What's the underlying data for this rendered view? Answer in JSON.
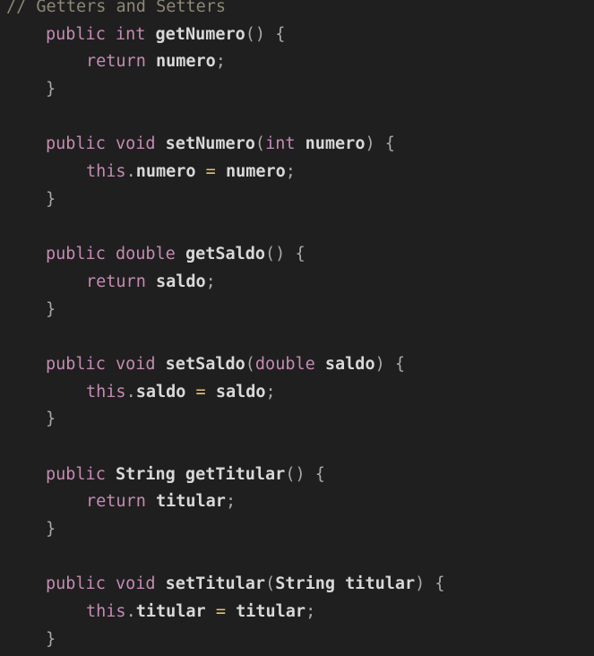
{
  "editor": {
    "theme": {
      "background": "#1f1f1f",
      "comment": "#8d8776",
      "keyword": "#c58bb3",
      "identifier": "#d8d8d8",
      "punctuation": "#a9a9a9",
      "operator": "#e7c274"
    },
    "lines": [
      {
        "indent": 0,
        "tokens": [
          {
            "t": "comment",
            "v": "// Getters and Setters"
          }
        ]
      },
      {
        "indent": 1,
        "tokens": [
          {
            "t": "kw",
            "v": "public int"
          },
          {
            "t": "text",
            "v": " "
          },
          {
            "t": "ident",
            "v": "getNumero"
          },
          {
            "t": "punc",
            "v": "() {"
          }
        ]
      },
      {
        "indent": 2,
        "tokens": [
          {
            "t": "kw",
            "v": "return"
          },
          {
            "t": "text",
            "v": " "
          },
          {
            "t": "ident",
            "v": "numero"
          },
          {
            "t": "punc",
            "v": ";"
          }
        ]
      },
      {
        "indent": 1,
        "tokens": [
          {
            "t": "punc",
            "v": "}"
          }
        ]
      },
      {
        "indent": 0,
        "tokens": []
      },
      {
        "indent": 1,
        "tokens": [
          {
            "t": "kw",
            "v": "public void"
          },
          {
            "t": "text",
            "v": " "
          },
          {
            "t": "ident",
            "v": "setNumero"
          },
          {
            "t": "punc",
            "v": "("
          },
          {
            "t": "kw",
            "v": "int"
          },
          {
            "t": "text",
            "v": " "
          },
          {
            "t": "ident",
            "v": "numero"
          },
          {
            "t": "punc",
            "v": ") {"
          }
        ]
      },
      {
        "indent": 2,
        "tokens": [
          {
            "t": "kw",
            "v": "this"
          },
          {
            "t": "punc",
            "v": "."
          },
          {
            "t": "ident",
            "v": "numero"
          },
          {
            "t": "text",
            "v": " "
          },
          {
            "t": "op",
            "v": "="
          },
          {
            "t": "text",
            "v": " "
          },
          {
            "t": "ident",
            "v": "numero"
          },
          {
            "t": "punc",
            "v": ";"
          }
        ]
      },
      {
        "indent": 1,
        "tokens": [
          {
            "t": "punc",
            "v": "}"
          }
        ]
      },
      {
        "indent": 0,
        "tokens": []
      },
      {
        "indent": 1,
        "tokens": [
          {
            "t": "kw",
            "v": "public double"
          },
          {
            "t": "text",
            "v": " "
          },
          {
            "t": "ident",
            "v": "getSaldo"
          },
          {
            "t": "punc",
            "v": "() {"
          }
        ]
      },
      {
        "indent": 2,
        "tokens": [
          {
            "t": "kw",
            "v": "return"
          },
          {
            "t": "text",
            "v": " "
          },
          {
            "t": "ident",
            "v": "saldo"
          },
          {
            "t": "punc",
            "v": ";"
          }
        ]
      },
      {
        "indent": 1,
        "tokens": [
          {
            "t": "punc",
            "v": "}"
          }
        ]
      },
      {
        "indent": 0,
        "tokens": []
      },
      {
        "indent": 1,
        "tokens": [
          {
            "t": "kw",
            "v": "public void"
          },
          {
            "t": "text",
            "v": " "
          },
          {
            "t": "ident",
            "v": "setSaldo"
          },
          {
            "t": "punc",
            "v": "("
          },
          {
            "t": "kw",
            "v": "double"
          },
          {
            "t": "text",
            "v": " "
          },
          {
            "t": "ident",
            "v": "saldo"
          },
          {
            "t": "punc",
            "v": ") {"
          }
        ]
      },
      {
        "indent": 2,
        "tokens": [
          {
            "t": "kw",
            "v": "this"
          },
          {
            "t": "punc",
            "v": "."
          },
          {
            "t": "ident",
            "v": "saldo"
          },
          {
            "t": "text",
            "v": " "
          },
          {
            "t": "op",
            "v": "="
          },
          {
            "t": "text",
            "v": " "
          },
          {
            "t": "ident",
            "v": "saldo"
          },
          {
            "t": "punc",
            "v": ";"
          }
        ]
      },
      {
        "indent": 1,
        "tokens": [
          {
            "t": "punc",
            "v": "}"
          }
        ]
      },
      {
        "indent": 0,
        "tokens": []
      },
      {
        "indent": 1,
        "tokens": [
          {
            "t": "kw",
            "v": "public"
          },
          {
            "t": "text",
            "v": " "
          },
          {
            "t": "ident",
            "v": "String getTitular"
          },
          {
            "t": "punc",
            "v": "() {"
          }
        ]
      },
      {
        "indent": 2,
        "tokens": [
          {
            "t": "kw",
            "v": "return"
          },
          {
            "t": "text",
            "v": " "
          },
          {
            "t": "ident",
            "v": "titular"
          },
          {
            "t": "punc",
            "v": ";"
          }
        ]
      },
      {
        "indent": 1,
        "tokens": [
          {
            "t": "punc",
            "v": "}"
          }
        ]
      },
      {
        "indent": 0,
        "tokens": []
      },
      {
        "indent": 1,
        "tokens": [
          {
            "t": "kw",
            "v": "public void"
          },
          {
            "t": "text",
            "v": " "
          },
          {
            "t": "ident",
            "v": "setTitular"
          },
          {
            "t": "punc",
            "v": "("
          },
          {
            "t": "ident",
            "v": "String titular"
          },
          {
            "t": "punc",
            "v": ") {"
          }
        ]
      },
      {
        "indent": 2,
        "tokens": [
          {
            "t": "kw",
            "v": "this"
          },
          {
            "t": "punc",
            "v": "."
          },
          {
            "t": "ident",
            "v": "titular"
          },
          {
            "t": "text",
            "v": " "
          },
          {
            "t": "op",
            "v": "="
          },
          {
            "t": "text",
            "v": " "
          },
          {
            "t": "ident",
            "v": "titular"
          },
          {
            "t": "punc",
            "v": ";"
          }
        ]
      },
      {
        "indent": 1,
        "tokens": [
          {
            "t": "punc",
            "v": "}"
          }
        ]
      }
    ]
  }
}
